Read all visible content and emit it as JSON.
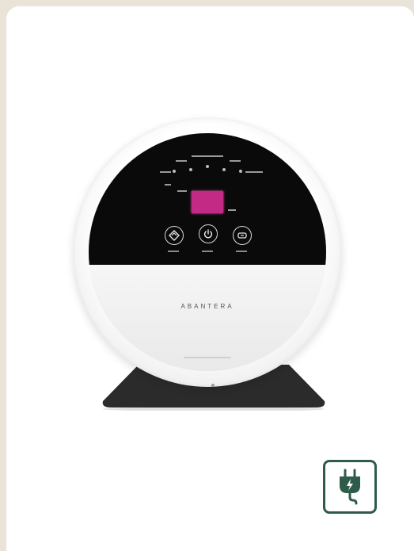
{
  "product": {
    "brand_text": "ABANTERA"
  },
  "badge": {
    "icon": "electric-plug-icon",
    "color": "#2f5b4b"
  },
  "colors": {
    "background": "#e9e3d8",
    "card": "#ffffff",
    "display": "#c22a86"
  }
}
